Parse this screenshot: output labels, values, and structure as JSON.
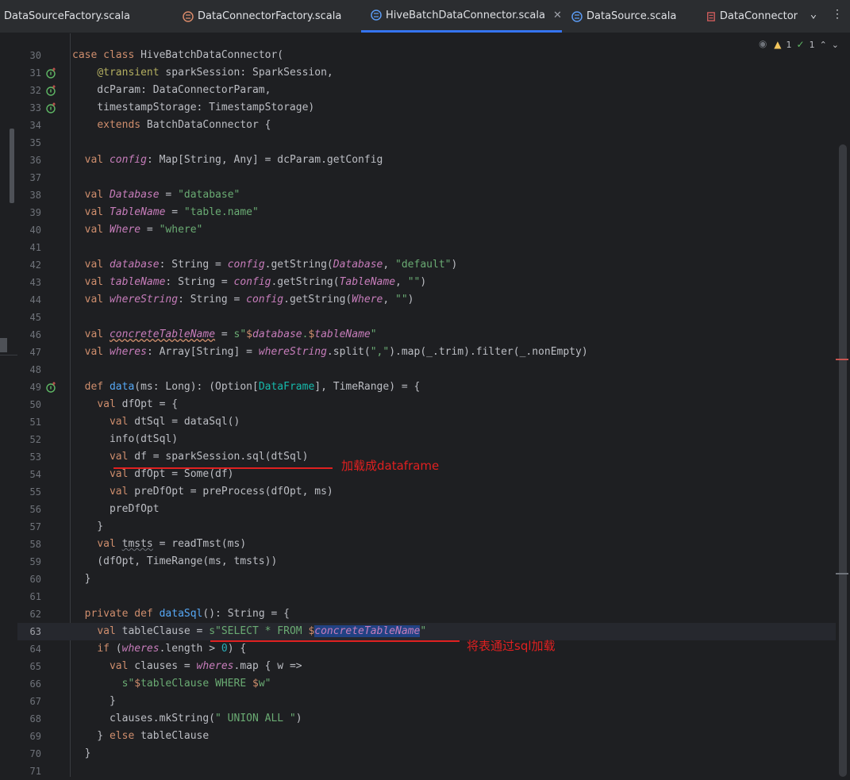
{
  "tabs": [
    {
      "label": "DataSourceFactory.scala",
      "icon": "scala-object-icon",
      "active": false
    },
    {
      "label": "DataConnectorFactory.scala",
      "icon": "scala-object-icon",
      "active": false
    },
    {
      "label": "HiveBatchDataConnector.scala",
      "icon": "scala-class-icon",
      "active": true
    },
    {
      "label": "DataSource.scala",
      "icon": "scala-class-icon",
      "active": false
    },
    {
      "label": "DataConnector",
      "icon": "scala-trait-icon",
      "active": false
    }
  ],
  "inspections": {
    "warnings": "1",
    "ok": "1"
  },
  "annotations": {
    "note1": "加载成dataframe",
    "note2": "将表通过sql加载"
  },
  "current_line": 63,
  "code": {
    "lines": [
      {
        "n": "30",
        "t": "case class HiveBatchDataConnector("
      },
      {
        "n": "31",
        "t": "    @transient sparkSession: SparkSession,"
      },
      {
        "n": "32",
        "t": "    dcParam: DataConnectorParam,"
      },
      {
        "n": "33",
        "t": "    timestampStorage: TimestampStorage)"
      },
      {
        "n": "34",
        "t": "    extends BatchDataConnector {"
      },
      {
        "n": "35",
        "t": ""
      },
      {
        "n": "36",
        "t": "  val config: Map[String, Any] = dcParam.getConfig"
      },
      {
        "n": "37",
        "t": ""
      },
      {
        "n": "38",
        "t": "  val Database = \"database\""
      },
      {
        "n": "39",
        "t": "  val TableName = \"table.name\""
      },
      {
        "n": "40",
        "t": "  val Where = \"where\""
      },
      {
        "n": "41",
        "t": ""
      },
      {
        "n": "42",
        "t": "  val database: String = config.getString(Database, \"default\")"
      },
      {
        "n": "43",
        "t": "  val tableName: String = config.getString(TableName, \"\")"
      },
      {
        "n": "44",
        "t": "  val whereString: String = config.getString(Where, \"\")"
      },
      {
        "n": "45",
        "t": ""
      },
      {
        "n": "46",
        "t": "  val concreteTableName = s\"$database.$tableName\""
      },
      {
        "n": "47",
        "t": "  val wheres: Array[String] = whereString.split(\",\").map(_.trim).filter(_.nonEmpty)"
      },
      {
        "n": "48",
        "t": ""
      },
      {
        "n": "49",
        "t": "  def data(ms: Long): (Option[DataFrame], TimeRange) = {"
      },
      {
        "n": "50",
        "t": "    val dfOpt = {"
      },
      {
        "n": "51",
        "t": "      val dtSql = dataSql()"
      },
      {
        "n": "52",
        "t": "      info(dtSql)"
      },
      {
        "n": "53",
        "t": "      val df = sparkSession.sql(dtSql)"
      },
      {
        "n": "54",
        "t": "      val dfOpt = Some(df)"
      },
      {
        "n": "55",
        "t": "      val preDfOpt = preProcess(dfOpt, ms)"
      },
      {
        "n": "56",
        "t": "      preDfOpt"
      },
      {
        "n": "57",
        "t": "    }"
      },
      {
        "n": "58",
        "t": "    val tmsts = readTmst(ms)"
      },
      {
        "n": "59",
        "t": "    (dfOpt, TimeRange(ms, tmsts))"
      },
      {
        "n": "60",
        "t": "  }"
      },
      {
        "n": "61",
        "t": ""
      },
      {
        "n": "62",
        "t": "  private def dataSql(): String = {"
      },
      {
        "n": "63",
        "t": "    val tableClause = s\"SELECT * FROM $concreteTableName\""
      },
      {
        "n": "64",
        "t": "    if (wheres.length > 0) {"
      },
      {
        "n": "65",
        "t": "      val clauses = wheres.map { w =>"
      },
      {
        "n": "66",
        "t": "        s\"$tableClause WHERE $w\""
      },
      {
        "n": "67",
        "t": "      }"
      },
      {
        "n": "68",
        "t": "      clauses.mkString(\" UNION ALL \")"
      },
      {
        "n": "69",
        "t": "    } else tableClause"
      },
      {
        "n": "70",
        "t": "  }"
      },
      {
        "n": "71",
        "t": ""
      }
    ]
  },
  "colors": {
    "keyword": "#cf8e6d",
    "field": "#c77dbb",
    "string": "#6aab73",
    "annotation_red": "#e02020",
    "accent": "#3574f0"
  }
}
